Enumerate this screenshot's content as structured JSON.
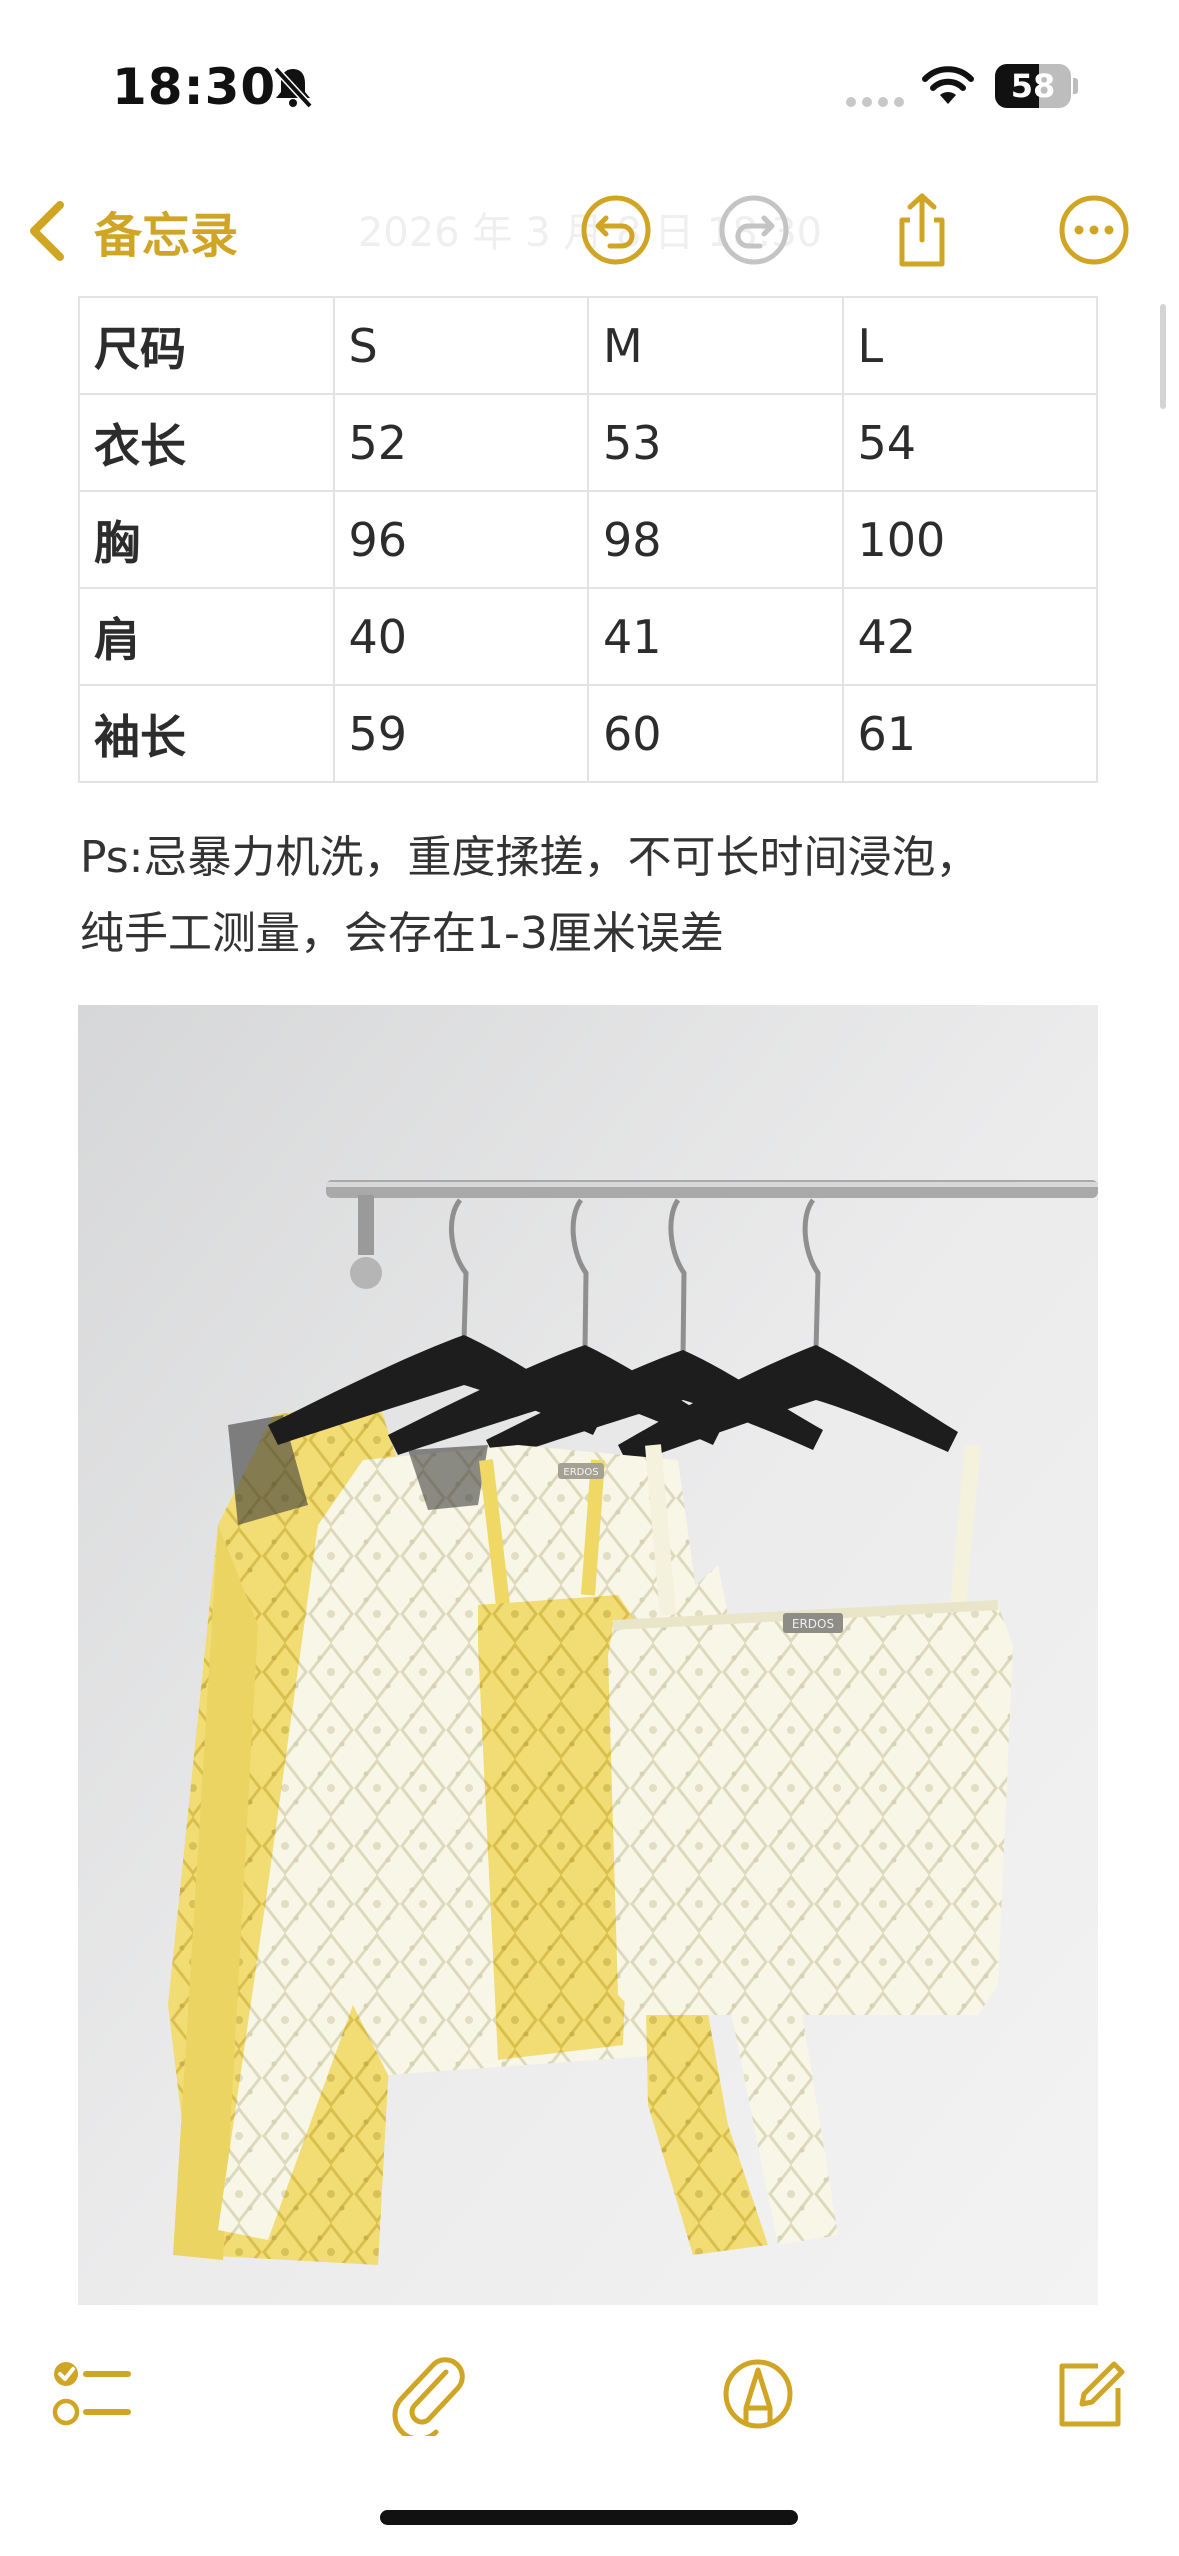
{
  "status_bar": {
    "time": "18:30",
    "battery_percent": 58,
    "battery_label": "58",
    "icons": [
      "bell-slash-icon",
      "cellular-dots-icon",
      "wifi-icon",
      "battery-icon"
    ]
  },
  "nav": {
    "back_label": "备忘录",
    "date_text": "2026 年 3 月 8 日 18:30",
    "icons": [
      "chevron-left-icon",
      "undo-icon",
      "redo-icon",
      "share-icon",
      "ellipsis-icon"
    ]
  },
  "size_table": {
    "rows": [
      [
        "尺码",
        "S",
        "M",
        "L"
      ],
      [
        "衣长",
        "52",
        "53",
        "54"
      ],
      [
        "胸",
        "96",
        "98",
        "100"
      ],
      [
        "肩",
        "40",
        "41",
        "42"
      ],
      [
        "袖长",
        "59",
        "60",
        "61"
      ]
    ]
  },
  "note": {
    "line1": "Ps:忌暴力机洗，重度揉搓，不可长时间浸泡，",
    "line2": "纯手工测量，会存在1-3厘米误差"
  },
  "photo": {
    "tag1": "ERDOS",
    "tag2": "ERDOS"
  },
  "toolbar": {
    "icons": [
      "checklist-icon",
      "paperclip-icon",
      "markup-pen-icon",
      "compose-icon"
    ]
  },
  "colors": {
    "accent": "#d1a524",
    "redo_disabled": "#c4c4c4",
    "table_border": "#e3e3e3",
    "yellow_knit": "#f2dd7a",
    "cream_knit": "#f7f4e2"
  }
}
